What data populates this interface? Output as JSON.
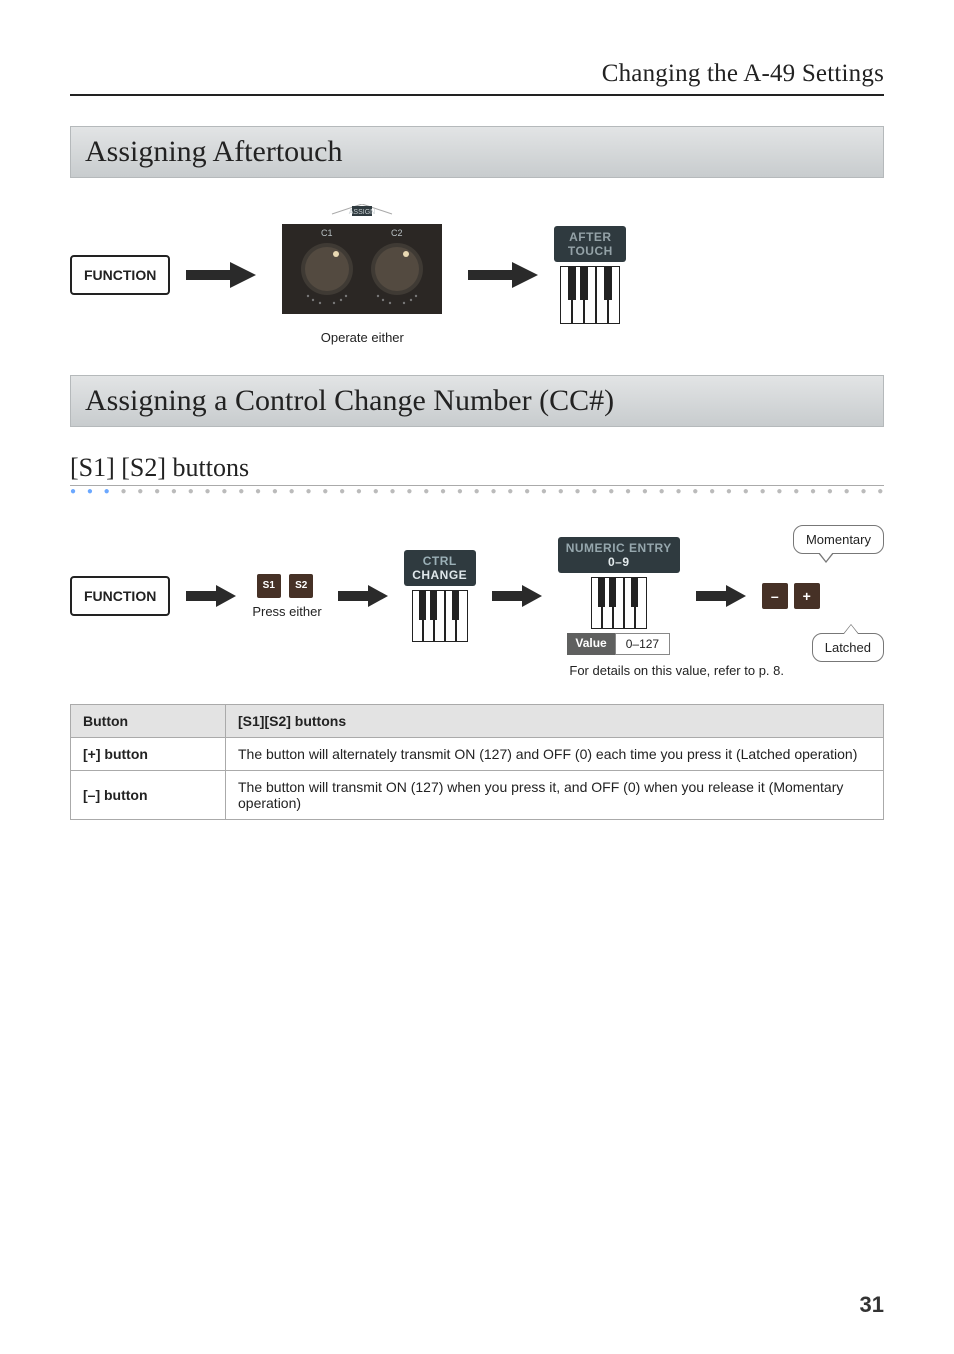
{
  "header": {
    "title": "Changing the A-49 Settings"
  },
  "section1": {
    "title": "Assigning Aftertouch",
    "function_label": "FUNCTION",
    "operate_caption": "Operate either",
    "key_label": "AFTER\nTOUCH",
    "assign_text": "ASSIGN",
    "knob_c1": "C1",
    "knob_c2": "C2"
  },
  "section2": {
    "title": "Assigning a Control Change Number (CC#)"
  },
  "sub1": {
    "title": "[S1] [S2] buttons",
    "function_label": "FUNCTION",
    "press_caption": "Press either",
    "s1": "S1",
    "s2": "S2",
    "ctrl_label_top": "CTRL",
    "ctrl_label_bot": "CHANGE",
    "numeric_label_top": "NUMERIC ENTRY",
    "numeric_label_bot": "0–9",
    "value_header": "Value",
    "value_range": "0–127",
    "footnote": "For details on this value, refer to p. 8.",
    "bubble_momentary": "Momentary",
    "bubble_latched": "Latched",
    "minus": "–",
    "plus": "+"
  },
  "table": {
    "h_button": "Button",
    "h_s1s2": "[S1][S2] buttons",
    "r1_head": "[+] button",
    "r1_text": "The button will alternately transmit ON (127) and OFF (0) each time you press it (Latched operation)",
    "r2_head": "[–] button",
    "r2_text": "The button will transmit ON (127) when you press it, and OFF (0) when you release it (Momentary operation)"
  },
  "page_number": "31"
}
